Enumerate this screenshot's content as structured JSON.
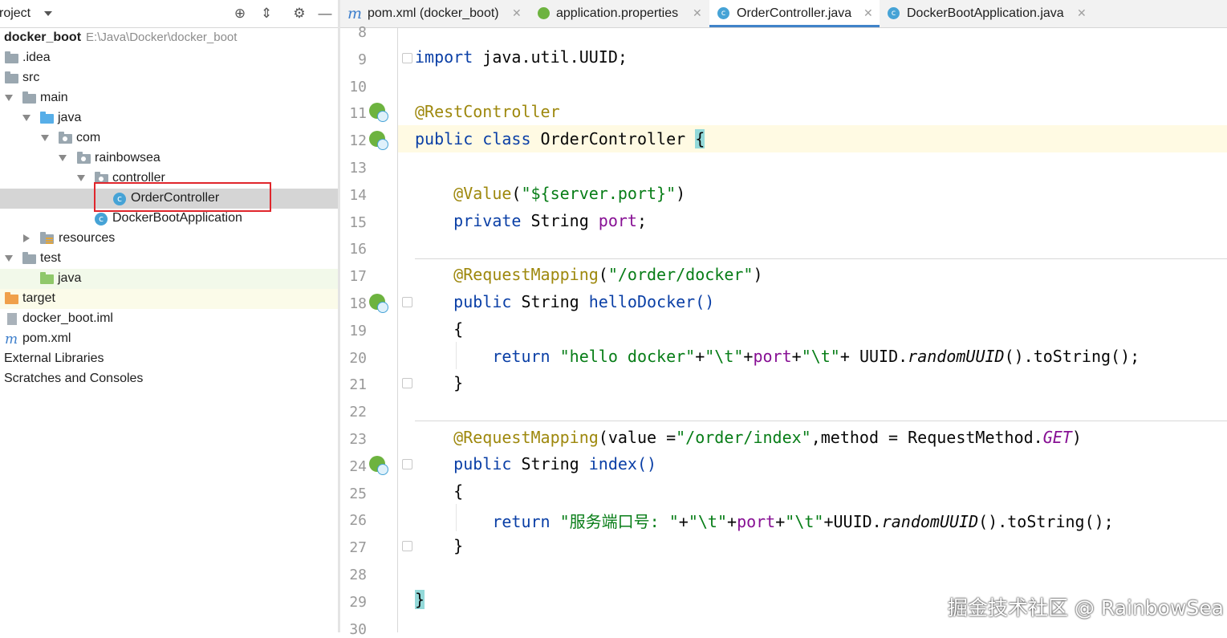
{
  "project_panel": {
    "title": "roject",
    "tree": [
      {
        "label": "docker_boot",
        "path": "E:\\Java\\Docker\\docker_boot"
      },
      {
        "label": ".idea"
      },
      {
        "label": "src"
      },
      {
        "label": "main"
      },
      {
        "label": "java"
      },
      {
        "label": "com"
      },
      {
        "label": "rainbowsea"
      },
      {
        "label": "controller"
      },
      {
        "label": "OrderController",
        "selected": true
      },
      {
        "label": "DockerBootApplication"
      },
      {
        "label": "resources"
      },
      {
        "label": "test"
      },
      {
        "label": "java"
      },
      {
        "label": "target"
      },
      {
        "label": "docker_boot.iml"
      },
      {
        "label": "pom.xml"
      },
      {
        "label": "External Libraries"
      },
      {
        "label": "Scratches and Consoles"
      }
    ]
  },
  "tabs": [
    {
      "label": "pom.xml (docker_boot)",
      "icon": "maven-icon"
    },
    {
      "label": "application.properties",
      "icon": "spring-config-icon"
    },
    {
      "label": "OrderController.java",
      "icon": "class-icon",
      "active": true
    },
    {
      "label": "DockerBootApplication.java",
      "icon": "spring-class-icon"
    }
  ],
  "editor": {
    "line_numbers": [
      "8",
      "9",
      "10",
      "11",
      "12",
      "13",
      "14",
      "15",
      "16",
      "17",
      "18",
      "19",
      "20",
      "21",
      "22",
      "23",
      "24",
      "25",
      "26",
      "27",
      "28",
      "29",
      "30"
    ],
    "code": {
      "l9": [
        "import",
        " java.util.UUID;"
      ],
      "l11": [
        "@RestController"
      ],
      "l12": [
        "public class",
        " OrderController ",
        "{"
      ],
      "l14": [
        "@Value",
        "(",
        "\"${server.port}\"",
        ")"
      ],
      "l15": [
        "private",
        " String ",
        "port",
        ";"
      ],
      "l17": [
        "@RequestMapping",
        "(",
        "\"/order/docker\"",
        ")"
      ],
      "l18": [
        "public",
        " String ",
        "helloDocker()"
      ],
      "l19": [
        "{"
      ],
      "l20": [
        "return",
        " ",
        "\"hello docker\"",
        "+",
        "\"\\t\"",
        "+",
        "port",
        "+",
        "\"\\t\"",
        "+ UUID.",
        "randomUUID",
        "().toString();"
      ],
      "l21": [
        "}"
      ],
      "l23": [
        "@RequestMapping",
        "(value =",
        "\"/order/index\"",
        ",method = RequestMethod.",
        "GET",
        ")"
      ],
      "l24": [
        "public",
        " String ",
        "index()"
      ],
      "l25": [
        "{"
      ],
      "l26": [
        "return",
        " ",
        "\"服务端口号: \"",
        "+",
        "\"\\t\"",
        "+",
        "port",
        "+",
        "\"\\t\"",
        "+UUID.",
        "randomUUID",
        "().toString();"
      ],
      "l27": [
        "}"
      ],
      "l29": [
        "}"
      ]
    }
  },
  "watermark": "掘金技术社区 @ RainbowSea",
  "colors": {
    "keyword": "#0a3fa6",
    "annotation": "#9e880d",
    "string": "#077d17",
    "field": "#871094",
    "selection_box": "#e0262c"
  }
}
